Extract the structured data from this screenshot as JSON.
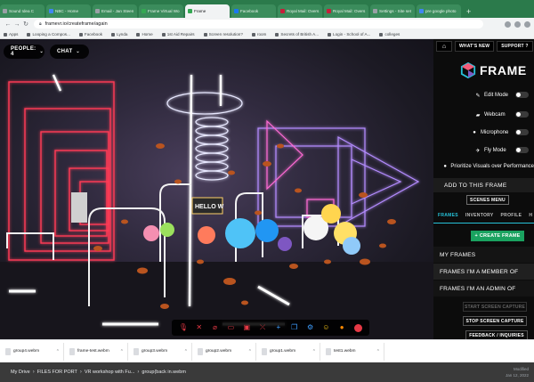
{
  "browser": {
    "tabs": [
      {
        "label": "Sound Idea C",
        "icon": "document-icon",
        "active": false
      },
      {
        "label": "NBC - Home",
        "icon": "nbc-icon",
        "active": false
      },
      {
        "label": "Email - Jan Steen",
        "icon": "mail-icon",
        "active": false
      },
      {
        "label": "Frame Virtual Wo",
        "icon": "frame-icon",
        "active": false
      },
      {
        "label": "Frame",
        "icon": "frame-icon",
        "active": true
      },
      {
        "label": "Facebook",
        "icon": "facebook-icon",
        "active": false
      },
      {
        "label": "Royal Mail: Overs",
        "icon": "royal-mail-icon",
        "active": false
      },
      {
        "label": "Royal Mail: Overs",
        "icon": "royal-mail-icon",
        "active": false
      },
      {
        "label": "Settings - Site set",
        "icon": "gear-icon",
        "active": false
      },
      {
        "label": "pre google photo",
        "icon": "google-icon",
        "active": false
      }
    ],
    "url": "framevr.io/createframe/again",
    "bookmarks": [
      {
        "label": "Apps"
      },
      {
        "label": "Looping a Compos..."
      },
      {
        "label": "Facebook"
      },
      {
        "label": "Lynda"
      },
      {
        "label": "Home"
      },
      {
        "label": "1st Aid Repairs"
      },
      {
        "label": "Screen resolution?"
      },
      {
        "label": "room"
      },
      {
        "label": "Secrets of British A..."
      },
      {
        "label": "Login - School of A..."
      },
      {
        "label": "colleges"
      }
    ]
  },
  "scene": {
    "people_label": "PEOPLE: 4",
    "chat_label": "CHAT",
    "sign_text": "HELLO W"
  },
  "toolbar": {
    "buttons": [
      {
        "icon": "microphone-off-icon",
        "glyph": "🎙",
        "color": "red"
      },
      {
        "icon": "camera-off-icon",
        "glyph": "✕",
        "color": "red"
      },
      {
        "icon": "video-off-icon",
        "glyph": "⌀",
        "color": "red"
      },
      {
        "icon": "screen-share-icon",
        "glyph": "▭",
        "color": "red"
      },
      {
        "icon": "screen-share-off-icon",
        "glyph": "▣",
        "color": "red"
      },
      {
        "icon": "pointer-off-icon",
        "glyph": "⤫",
        "color": "red"
      },
      {
        "icon": "add-icon",
        "glyph": "+",
        "color": "blue"
      },
      {
        "icon": "copy-icon",
        "glyph": "❐",
        "color": "blue"
      },
      {
        "icon": "settings-icon",
        "glyph": "⚙",
        "color": "blue"
      },
      {
        "icon": "emoji-icon",
        "glyph": "☺",
        "color": "yellow"
      },
      {
        "icon": "ball-icon",
        "glyph": "●",
        "color": "orange"
      },
      {
        "icon": "record-icon",
        "glyph": "",
        "color": "record"
      }
    ]
  },
  "panel": {
    "top_buttons": {
      "home_icon": "home-icon",
      "whats_new": "WHAT'S NEW",
      "support": "SUPPORT"
    },
    "brand": "FRAME",
    "toggles": [
      {
        "label": "Edit Mode",
        "icon": "edit-icon",
        "glyph": "✎",
        "on": false
      },
      {
        "label": "Webcam",
        "icon": "webcam-icon",
        "glyph": "▰",
        "on": false
      },
      {
        "label": "Microphone",
        "icon": "microphone-icon",
        "glyph": "●",
        "on": false
      },
      {
        "label": "Fly Mode",
        "icon": "fly-icon",
        "glyph": "✈",
        "on": false
      },
      {
        "label": "Prioritize Visuals over Performance",
        "icon": "visuals-icon",
        "glyph": "●",
        "on": false
      }
    ],
    "add_to_frame": "ADD TO THIS FRAME",
    "scenes_menu": "SCENES MENU",
    "tabs": [
      {
        "label": "FRAMES",
        "active": true
      },
      {
        "label": "INVENTORY",
        "active": false
      },
      {
        "label": "PROFILE",
        "active": false
      },
      {
        "label": "H",
        "active": false
      }
    ],
    "create_frame": "CREATE FRAME",
    "frame_lists": [
      "MY FRAMES",
      "FRAMES I'M A MEMBER OF",
      "FRAMES I'M AN ADMIN OF"
    ],
    "start_capture": "START SCREEN CAPTURE",
    "stop_capture": "STOP SCREEN CAPTURE",
    "feedback": "FEEDBACK / INQUIRIES"
  },
  "downloads": [
    {
      "name": "group4.webm"
    },
    {
      "name": "frame-test.webm"
    },
    {
      "name": "group3.webm"
    },
    {
      "name": "group2.webm"
    },
    {
      "name": "group1.webm"
    },
    {
      "name": "test1.webm"
    }
  ],
  "drive_path": {
    "segments": [
      "My Drive",
      "FILES FOR PORT",
      "VR workshop with Fu...",
      "group(back in.webm"
    ],
    "date_line1": "Modified",
    "date_line2": "Jan 12, 2022"
  }
}
